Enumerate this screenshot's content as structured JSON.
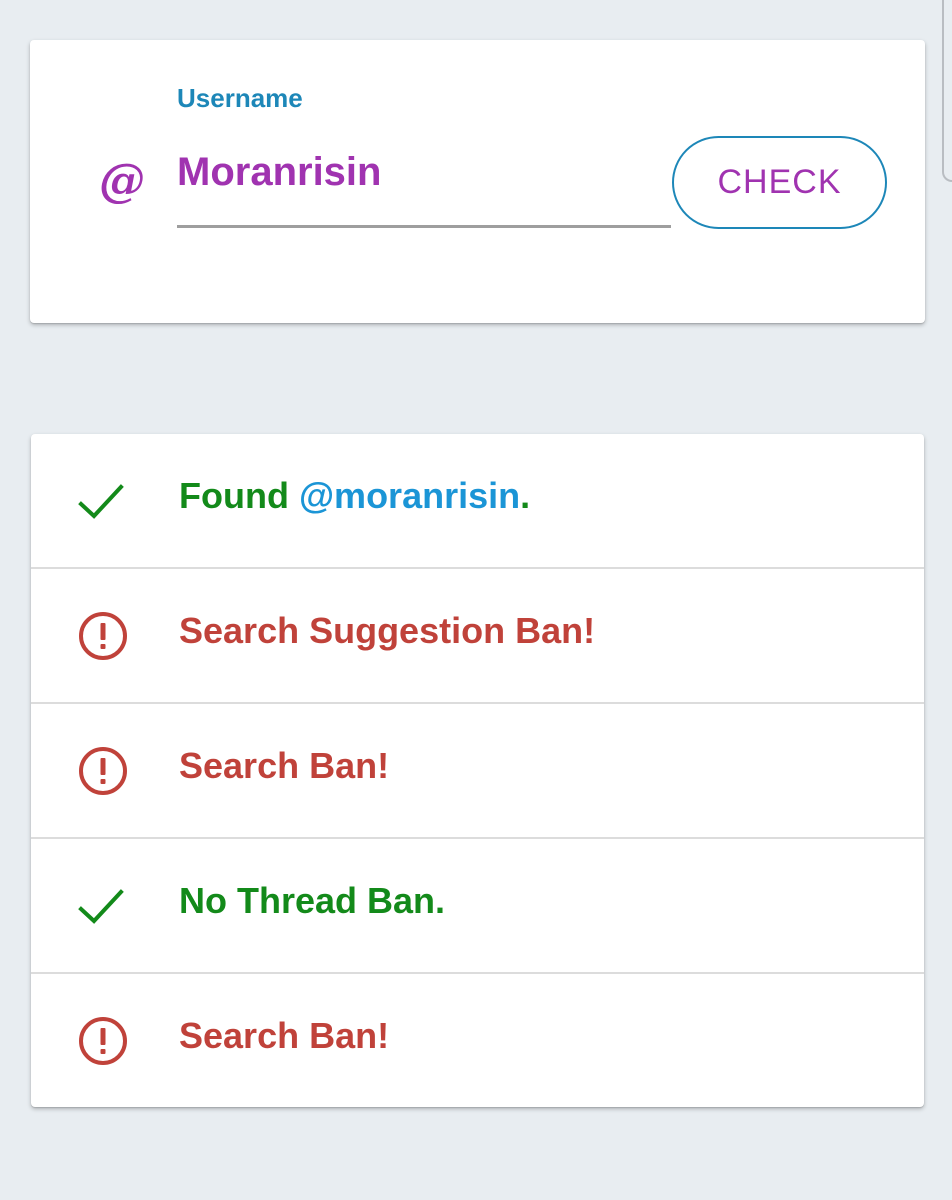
{
  "colors": {
    "page_background": "#e8edf1",
    "accent_purple": "#a033b0",
    "label_blue": "#1d87b8",
    "success_green": "#138a1a",
    "handle_blue": "#1b95d6",
    "error_red": "#c0423a"
  },
  "search": {
    "icon": "at-sign-icon",
    "icon_glyph": "@",
    "label": "Username",
    "value": "Moranrisin",
    "button_label": "CHECK"
  },
  "results": [
    {
      "status": "success",
      "icon": "check-icon",
      "text": "Found ",
      "handle": "@moranrisin",
      "suffix": "."
    },
    {
      "status": "error",
      "icon": "alert-circle-icon",
      "text": "Search Suggestion Ban!"
    },
    {
      "status": "error",
      "icon": "alert-circle-icon",
      "text": "Search Ban!"
    },
    {
      "status": "success",
      "icon": "check-icon",
      "text": "No Thread Ban."
    },
    {
      "status": "error",
      "icon": "alert-circle-icon",
      "text": "Search Ban!"
    }
  ]
}
